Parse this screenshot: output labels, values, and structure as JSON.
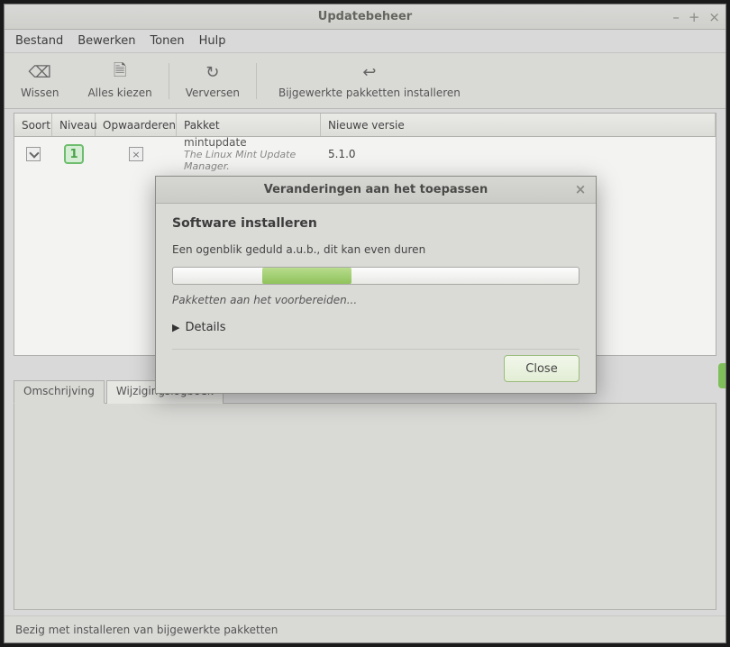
{
  "window": {
    "title": "Updatebeheer"
  },
  "menu": {
    "items": [
      "Bestand",
      "Bewerken",
      "Tonen",
      "Hulp"
    ]
  },
  "toolbar": {
    "clear": "Wissen",
    "select_all": "Alles kiezen",
    "refresh": "Verversen",
    "install": "Bijgewerkte pakketten installeren"
  },
  "table": {
    "headers": {
      "soort": "Soort",
      "niveau": "Niveau",
      "opwaarderen": "Opwaarderen",
      "pakket": "Pakket",
      "versie": "Nieuwe versie"
    },
    "rows": [
      {
        "level": "1",
        "pkg": "mintupdate",
        "desc": "The Linux Mint Update Manager.",
        "version": "5.1.0"
      }
    ]
  },
  "tabs": {
    "description": "Omschrijving",
    "changelog": "Wijzigingslogboek"
  },
  "status": "Bezig met installeren van bijgewerkte pakketten",
  "dialog": {
    "title": "Veranderingen aan het toepassen",
    "heading": "Software installeren",
    "message": "Een ogenblik geduld a.u.b., dit kan even duren",
    "substatus": "Pakketten aan het voorbereiden...",
    "details": "Details",
    "close": "Close"
  }
}
